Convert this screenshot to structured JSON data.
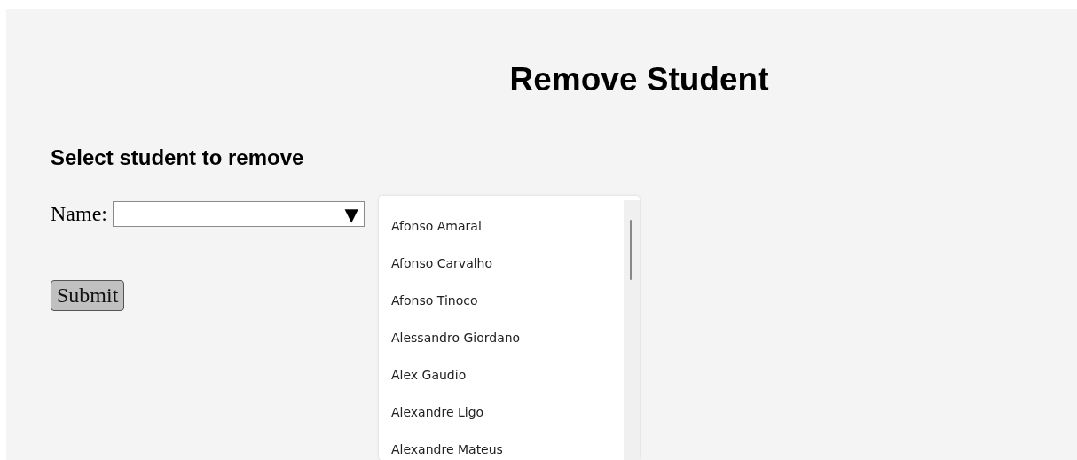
{
  "title": "Remove Student",
  "form": {
    "heading": "Select student to remove",
    "field_label": "Name:",
    "select": {
      "caret": "▼"
    },
    "submit": "Submit"
  },
  "dropdown": {
    "options": [
      "Afonso Amaral",
      "Afonso Carvalho",
      "Afonso Tinoco",
      "Alessandro Giordano",
      "Alex Gaudio",
      "Alexandre Ligo",
      "Alexandre Mateus"
    ]
  }
}
